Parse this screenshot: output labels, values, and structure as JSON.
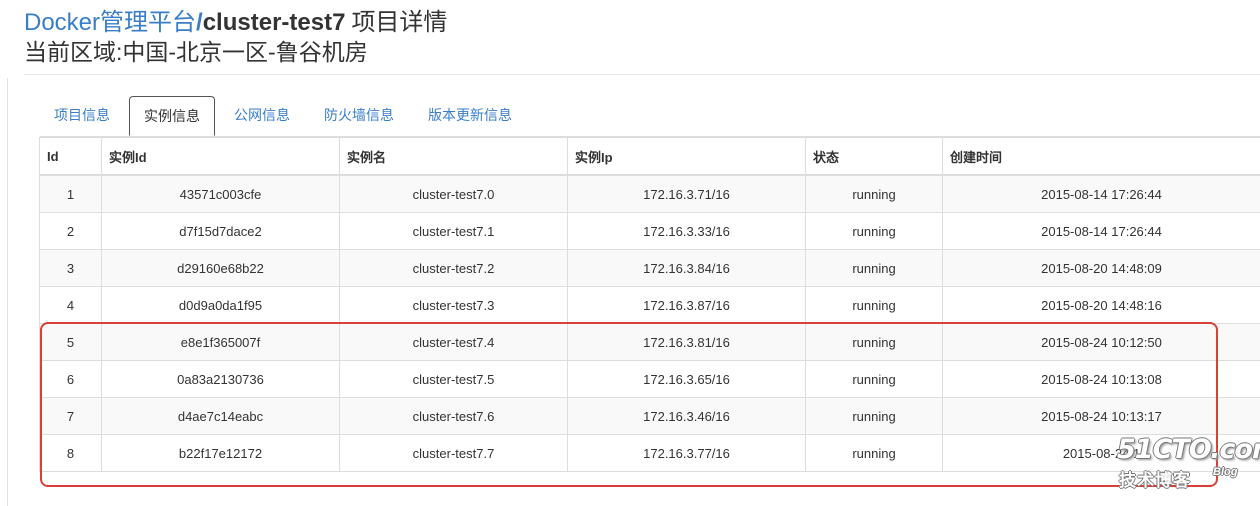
{
  "header": {
    "brand": "Docker管理平台",
    "separator": "/",
    "project": "cluster-test7",
    "title_suffix": "项目详情",
    "region": "当前区域:中国-北京一区-鲁谷机房"
  },
  "tabs": [
    {
      "label": "项目信息",
      "active": false
    },
    {
      "label": "实例信息",
      "active": true
    },
    {
      "label": "公网信息",
      "active": false
    },
    {
      "label": "防火墙信息",
      "active": false
    },
    {
      "label": "版本更新信息",
      "active": false
    }
  ],
  "table": {
    "headers": [
      "Id",
      "实例Id",
      "实例名",
      "实例Ip",
      "状态",
      "创建时间"
    ],
    "rows": [
      [
        "1",
        "43571c003cfe",
        "cluster-test7.0",
        "172.16.3.71/16",
        "running",
        "2015-08-14 17:26:44"
      ],
      [
        "2",
        "d7f15d7dace2",
        "cluster-test7.1",
        "172.16.3.33/16",
        "running",
        "2015-08-14 17:26:44"
      ],
      [
        "3",
        "d29160e68b22",
        "cluster-test7.2",
        "172.16.3.84/16",
        "running",
        "2015-08-20 14:48:09"
      ],
      [
        "4",
        "d0d9a0da1f95",
        "cluster-test7.3",
        "172.16.3.87/16",
        "running",
        "2015-08-20 14:48:16"
      ],
      [
        "5",
        "e8e1f365007f",
        "cluster-test7.4",
        "172.16.3.81/16",
        "running",
        "2015-08-24 10:12:50"
      ],
      [
        "6",
        "0a83a2130736",
        "cluster-test7.5",
        "172.16.3.65/16",
        "running",
        "2015-08-24 10:13:08"
      ],
      [
        "7",
        "d4ae7c14eabc",
        "cluster-test7.6",
        "172.16.3.46/16",
        "running",
        "2015-08-24 10:13:17"
      ],
      [
        "8",
        "b22f17e12172",
        "cluster-test7.7",
        "172.16.3.77/16",
        "running",
        "2015-08-24 1"
      ]
    ]
  },
  "watermark": {
    "main": "51CTO.com",
    "sub": "技术博客",
    "blog": "Blog"
  },
  "colors": {
    "link": "#3a7ec8",
    "highlight": "#d8403a"
  }
}
